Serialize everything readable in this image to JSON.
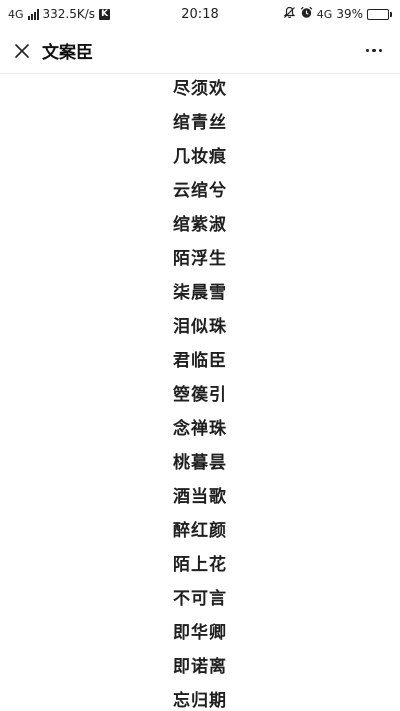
{
  "status_bar": {
    "network": "4G",
    "speed": "332.5K/s",
    "k_badge": "K",
    "time": "20:18",
    "network_right": "4G",
    "battery": "39%",
    "battery_level": 0.39,
    "icons": [
      "signal-icon",
      "k-app-icon",
      "mute-icon",
      "alarm-icon",
      "battery-icon"
    ]
  },
  "nav": {
    "title": "文案臣",
    "close_icon": "close-icon",
    "more_icon": "more-icon"
  },
  "names": [
    "尽须欢",
    "绾青丝",
    "几妆痕",
    "云绾兮",
    "绾紫淑",
    "陌浮生",
    "柒晨雪",
    "泪似珠",
    "君临臣",
    "箜篌引",
    "念禅珠",
    "桃暮昙",
    "酒当歌",
    "醉红颜",
    "陌上花",
    "不可言",
    "即华卿",
    "即诺离",
    "忘归期"
  ]
}
